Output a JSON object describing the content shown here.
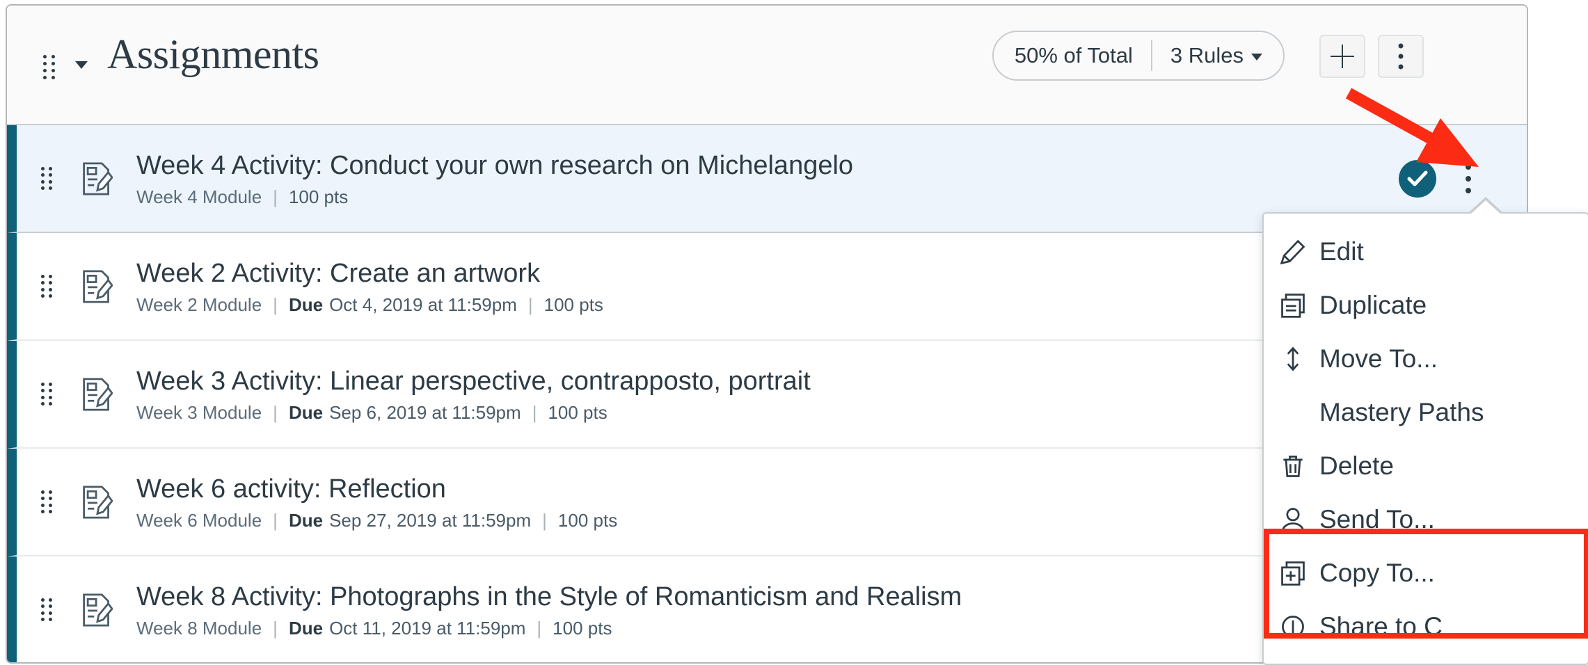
{
  "group": {
    "title": "Assignments",
    "drag_handle_icon": "drag-handle-icon",
    "collapse_icon": "caret-down-icon",
    "weight_label": "50% of Total",
    "rules_label": "3 Rules",
    "rules_caret_icon": "caret-down-icon",
    "add_button_icon": "plus-icon",
    "more_button_icon": "kebab-menu-icon"
  },
  "assignments": [
    {
      "title": "Week 4 Activity: Conduct your own research on Michelangelo",
      "module": "Week 4 Module",
      "due_label": "",
      "due": "",
      "points": "100 pts",
      "published": true,
      "selected": true,
      "icon": "assignment-icon"
    },
    {
      "title": "Week 2 Activity: Create an artwork",
      "module": "Week 2 Module",
      "due_label": "Due",
      "due": "Oct 4, 2019 at 11:59pm",
      "points": "100 pts",
      "published": false,
      "selected": false,
      "icon": "assignment-icon"
    },
    {
      "title": "Week 3 Activity: Linear perspective, contrapposto, portrait",
      "module": "Week 3 Module",
      "due_label": "Due",
      "due": "Sep 6, 2019 at 11:59pm",
      "points": "100 pts",
      "published": false,
      "selected": false,
      "icon": "assignment-icon"
    },
    {
      "title": "Week 6 activity: Reflection",
      "module": "Week 6 Module",
      "due_label": "Due",
      "due": "Sep 27, 2019 at 11:59pm",
      "points": "100 pts",
      "published": false,
      "selected": false,
      "icon": "assignment-icon"
    },
    {
      "title": "Week 8 Activity: Photographs in the Style of Romanticism and Realism",
      "module": "Week 8 Module",
      "due_label": "Due",
      "due": "Oct 11, 2019 at 11:59pm",
      "points": "100 pts",
      "published": false,
      "selected": false,
      "icon": "assignment-icon"
    }
  ],
  "separator": "|",
  "context_menu": {
    "items": [
      {
        "label": "Edit",
        "icon": "pencil-icon"
      },
      {
        "label": "Duplicate",
        "icon": "duplicate-icon"
      },
      {
        "label": "Move To...",
        "icon": "move-updown-icon"
      },
      {
        "label": "Mastery Paths",
        "icon": ""
      },
      {
        "label": "Delete",
        "icon": "trash-icon"
      },
      {
        "label": "Send To...",
        "icon": "user-icon"
      },
      {
        "label": "Copy To...",
        "icon": "copy-plus-icon"
      },
      {
        "label": "Share to C",
        "icon": "share-icon"
      }
    ]
  },
  "annotations": {
    "arrow_color": "#fc2b14",
    "box_color": "#fc2b14",
    "arrow_icon": "red-arrow-annotation",
    "box_icon": "red-highlight-box-annotation"
  },
  "colors": {
    "accent_teal": "#0e6179",
    "selected_row_bg": "#edf4fb",
    "text": "#2d3b45",
    "muted_text": "#5b6c79",
    "border": "#c7cdd1"
  }
}
